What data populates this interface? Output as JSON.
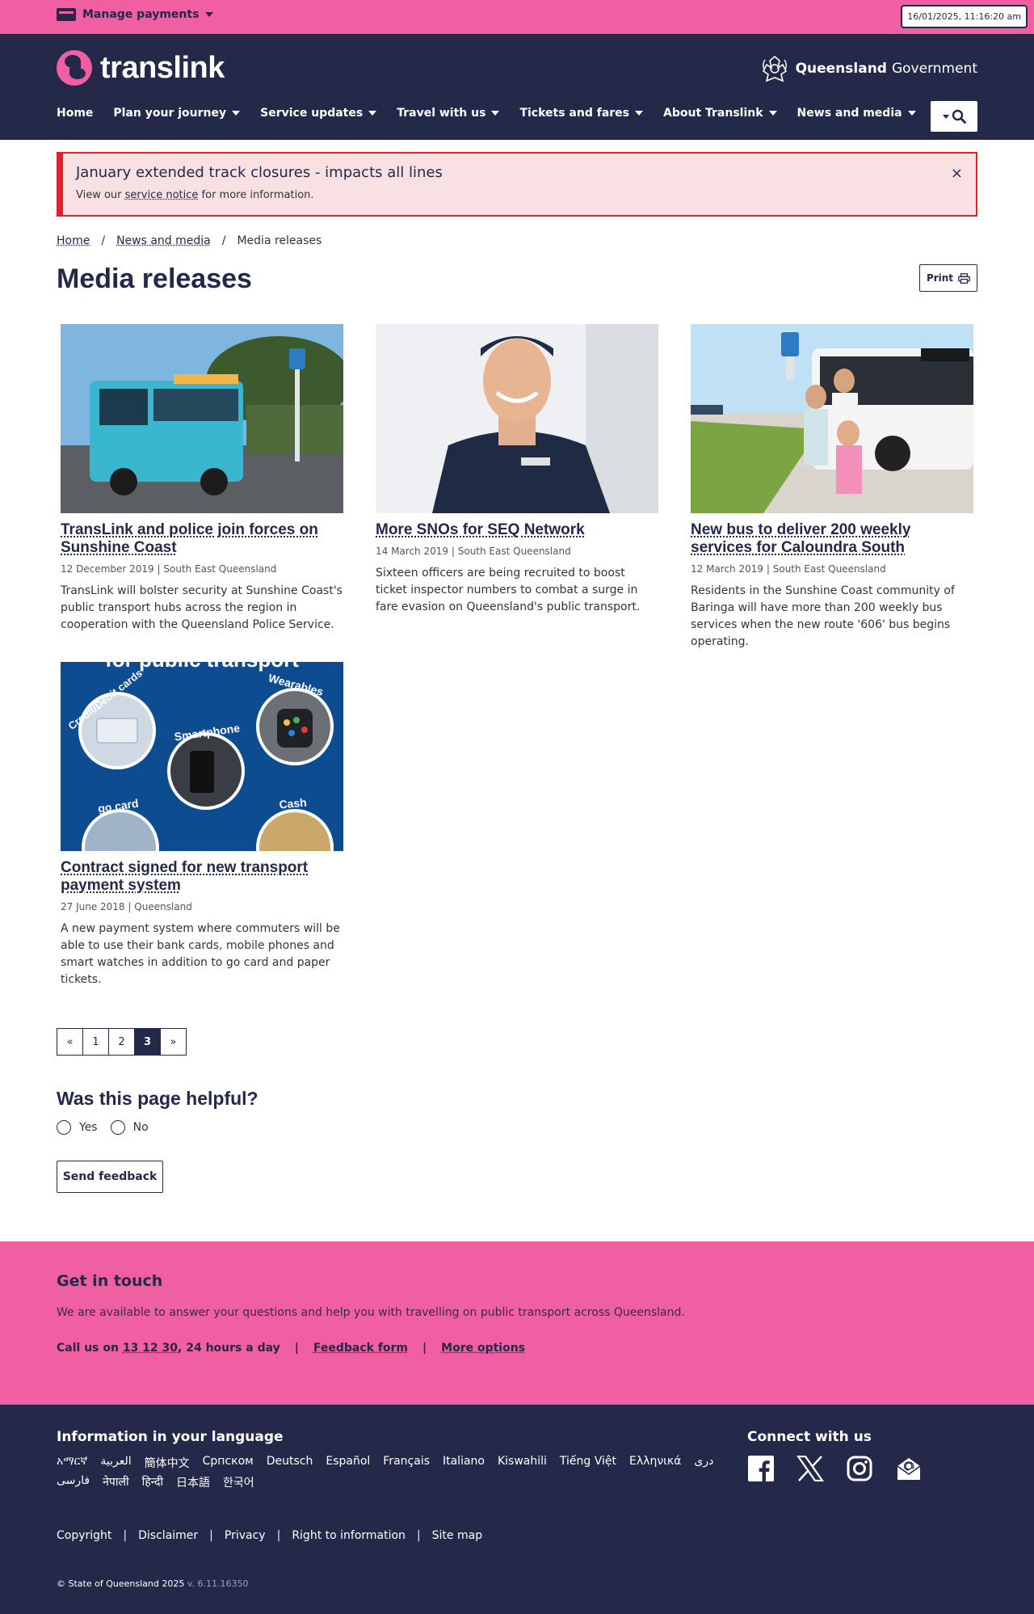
{
  "utility": {
    "manage_payments": "Manage payments",
    "datetime": "16/01/2025, 11:16:20 am"
  },
  "header": {
    "logo_text": "translink",
    "gov_name_bold": "Queensland",
    "gov_name": "Government",
    "nav": [
      {
        "label": "Home"
      },
      {
        "label": "Plan your journey"
      },
      {
        "label": "Service updates"
      },
      {
        "label": "Travel with us"
      },
      {
        "label": "Tickets and fares"
      },
      {
        "label": "About Translink"
      },
      {
        "label": "News and media"
      }
    ]
  },
  "alert": {
    "title": "January extended track closures - impacts all lines",
    "text_before": "View our ",
    "link": "service notice",
    "text_after": " for more information.",
    "close": "×"
  },
  "breadcrumb": {
    "items": [
      "Home",
      "News and media",
      "Media releases"
    ],
    "separator": "/"
  },
  "page": {
    "title": "Media releases",
    "print_label": "Print"
  },
  "articles": [
    {
      "title": "TransLink and police join forces on Sunshine Coast",
      "date": "12 December 2019",
      "region": "South East Queensland",
      "summary": "TransLink will bolster security at Sunshine Coast's public transport hubs across the region in cooperation with the Queensland Police Service."
    },
    {
      "title": "More SNOs for SEQ Network",
      "date": "14 March 2019",
      "region": "South East Queensland",
      "summary": "Sixteen officers are being recruited to boost ticket inspector numbers to combat a surge in fare evasion on Queensland's public transport."
    },
    {
      "title": "New bus to deliver 200 weekly services for Caloundra South",
      "date": "12 March 2019",
      "region": "South East Queensland",
      "summary": "Residents in the Sunshine Coast community of Baringa will have more than 200 weekly bus services when the new route '606' bus begins operating."
    },
    {
      "title": "Contract signed for new transport payment system",
      "date": "27 June 2018",
      "region": "Queensland",
      "summary": "A new payment system where commuters will be able to use their bank cards, mobile phones and smart watches in addition to go card and paper tickets."
    }
  ],
  "payment_graphic": {
    "banner": "for public transport",
    "labels": [
      "Credit/Debit cards",
      "Wearables",
      "Smartphone",
      "go card",
      "Cash"
    ]
  },
  "meta_separator": "|",
  "pagination": {
    "prev": "«",
    "pages": [
      "1",
      "2",
      "3"
    ],
    "current": "3",
    "next": "»"
  },
  "feedback": {
    "title": "Was this page helpful?",
    "yes": "Yes",
    "no": "No",
    "send": "Send feedback"
  },
  "contact": {
    "title": "Get in touch",
    "text": "We are available to answer your questions and help you with travelling on public transport across Queensland.",
    "call_prefix": "Call us on ",
    "phone": "13 12 30",
    "call_suffix": ", 24 hours a day",
    "feedback_form": "Feedback form",
    "more_options": "More options",
    "separator": "|"
  },
  "footer": {
    "language_title": "Information in your language",
    "languages": [
      "አማርኛ",
      "العربية",
      "簡体中文",
      "Српском",
      "Deutsch",
      "Español",
      "Français",
      "Italiano",
      "Kiswahili",
      "Tiếng Việt",
      "Ελληνικά",
      "دری",
      "فارسی",
      "नेपाली",
      "हिन्दी",
      "日本語",
      "한국어"
    ],
    "connect_title": "Connect with us",
    "social": [
      "facebook-icon",
      "x-icon",
      "instagram-icon",
      "email-icon"
    ],
    "links": [
      "Copyright",
      "Disclaimer",
      "Privacy",
      "Right to information",
      "Site map"
    ],
    "link_separator": "|",
    "copyright": "© State of Queensland 2025",
    "version": "v. 6.11.16350"
  },
  "colors": {
    "navy": "#24294a",
    "pink": "#ef5fa1",
    "alert_bg": "#f9e1e3",
    "alert_border": "#d9232f"
  }
}
